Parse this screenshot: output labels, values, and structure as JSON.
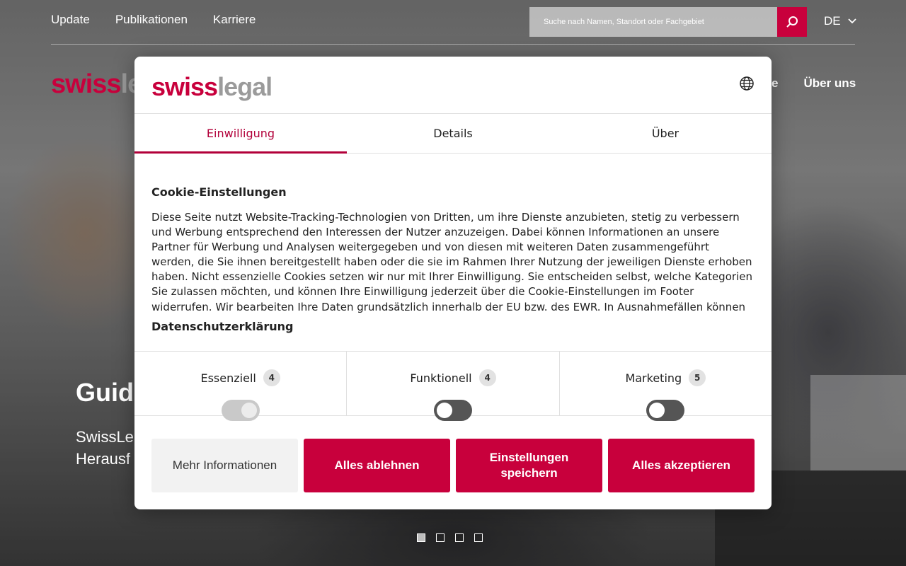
{
  "colors": {
    "brand": "#c8003c",
    "tab_active": "#b2003a",
    "logo_grey": "#9b9b9b"
  },
  "page": {
    "nav": [
      "Update",
      "Publikationen",
      "Karriere"
    ],
    "search": {
      "placeholder": "Suche nach Namen, Standort oder Fachgebiet"
    },
    "language": "DE",
    "logo": {
      "part1": "swiss",
      "part2": "le"
    },
    "main_nav": [
      "e",
      "Über uns"
    ],
    "hero": {
      "title": "Guid",
      "subtitle_line1": "SwissLe",
      "subtitle_line2": "Herausf"
    },
    "slider_dots": [
      true,
      false,
      false,
      false
    ]
  },
  "modal": {
    "logo": {
      "part1": "swiss",
      "part2": "legal"
    },
    "tabs": [
      "Einwilligung",
      "Details",
      "Über"
    ],
    "active_tab": 0,
    "heading": "Cookie-Einstellungen",
    "description": "Diese Seite nutzt Website-Tracking-Technologien von Dritten, um ihre Dienste anzubieten, stetig zu verbessern und Werbung entsprechend den Interessen der Nutzer anzuzeigen. Dabei können Informationen an unsere Partner für Werbung und Analysen weitergegeben und von diesen mit weiteren Daten zusammengeführt werden, die Sie ihnen bereitgestellt haben oder die sie im Rahmen Ihrer Nutzung der jeweiligen Dienste erhoben haben. Nicht essenzielle Cookies setzen wir nur mit Ihrer Einwilligung. Sie entscheiden selbst, welche Kategorien Sie zulassen möchten, und können Ihre Einwilligung jederzeit über die Cookie-Einstellungen im Footer widerrufen. Wir bearbeiten Ihre Daten grundsätzlich innerhalb der EU bzw. des EWR. In Ausnahmefällen können Daten durch Dienstleister ausserhalb der EU / des EWR bearbeitet werden. In den Detailbeschreibungen der",
    "privacy_link": "Datenschutzerklärung",
    "categories": [
      {
        "label": "Essenziell",
        "count": "4",
        "enabled": true
      },
      {
        "label": "Funktionell",
        "count": "4",
        "enabled": false
      },
      {
        "label": "Marketing",
        "count": "5",
        "enabled": false
      }
    ],
    "buttons": {
      "more": "Mehr Informationen",
      "reject": "Alles ablehnen",
      "save": "Einstellungen speichern",
      "accept": "Alles akzeptieren"
    }
  }
}
